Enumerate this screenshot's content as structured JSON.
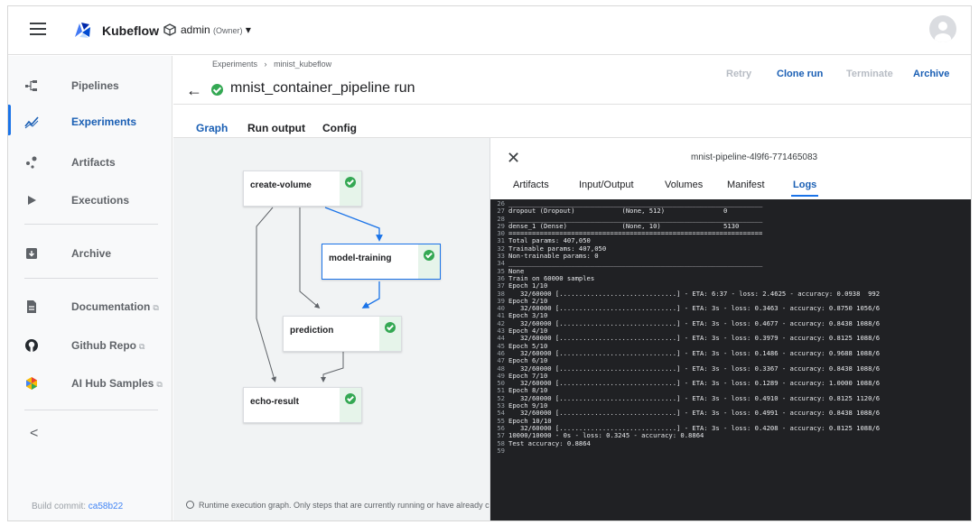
{
  "topbar": {
    "brand": "Kubeflow",
    "namespace": "admin",
    "namespace_role": "(Owner)",
    "namespace_caret": "▾"
  },
  "sidebar": {
    "items": [
      {
        "label": "Pipelines",
        "icon": "pipelines-icon"
      },
      {
        "label": "Experiments",
        "icon": "experiments-icon",
        "active": true
      },
      {
        "label": "Artifacts",
        "icon": "artifacts-icon"
      },
      {
        "label": "Executions",
        "icon": "executions-icon"
      },
      {
        "label": "Archive",
        "icon": "archive-icon"
      },
      {
        "label": "Documentation",
        "icon": "documentation-icon"
      },
      {
        "label": "Github Repo",
        "icon": "github-icon"
      },
      {
        "label": "AI Hub Samples",
        "icon": "ai-hub-icon"
      }
    ],
    "external_mark": "⧉",
    "collapse": "<",
    "build_label": "Build commit:",
    "build_commit": "ca58b22"
  },
  "header": {
    "breadcrumb": [
      "Experiments",
      "minist_kubeflow"
    ],
    "breadcrumb_sep": "›",
    "back": "←",
    "title": "mnist_container_pipeline run",
    "actions": {
      "retry": "Retry",
      "clone": "Clone run",
      "terminate": "Terminate",
      "archive": "Archive"
    }
  },
  "tabs": {
    "graph": "Graph",
    "run_output": "Run output",
    "config": "Config"
  },
  "graph": {
    "nodes": [
      "create-volume",
      "model-training",
      "prediction",
      "echo-result"
    ],
    "footer": "Runtime execution graph. Only steps that are currently running or have already completed are shown."
  },
  "panel": {
    "close": "✕",
    "title": "mnist-pipeline-4l9f6-771465083",
    "tabs": {
      "artifacts": "Artifacts",
      "io": "Input/Output",
      "volumes": "Volumes",
      "manifest": "Manifest",
      "logs": "Logs"
    }
  },
  "logs": [
    {
      "n": "26",
      "t": "_________________________________________________________________"
    },
    {
      "n": "27",
      "t": "dropout (Dropout)            (None, 512)               0"
    },
    {
      "n": "28",
      "t": "_________________________________________________________________"
    },
    {
      "n": "29",
      "t": "dense_1 (Dense)              (None, 10)                5130"
    },
    {
      "n": "30",
      "t": "================================================================="
    },
    {
      "n": "31",
      "t": "Total params: 407,050"
    },
    {
      "n": "32",
      "t": "Trainable params: 407,050"
    },
    {
      "n": "33",
      "t": "Non-trainable params: 0"
    },
    {
      "n": "34",
      "t": "_________________________________________________________________"
    },
    {
      "n": "35",
      "t": "None"
    },
    {
      "n": "36",
      "t": "Train on 60000 samples"
    },
    {
      "n": "37",
      "t": "Epoch 1/10"
    },
    {
      "n": "38",
      "t": "   32/60000 [..............................] - ETA: 6:37 - loss: 2.4625 - accuracy: 0.0938  992"
    },
    {
      "n": "39",
      "t": "Epoch 2/10"
    },
    {
      "n": "40",
      "t": "   32/60000 [..............................] - ETA: 3s - loss: 0.3463 - accuracy: 0.8750 1056/6"
    },
    {
      "n": "41",
      "t": "Epoch 3/10"
    },
    {
      "n": "42",
      "t": "   32/60000 [..............................] - ETA: 3s - loss: 0.4677 - accuracy: 0.8438 1088/6"
    },
    {
      "n": "43",
      "t": "Epoch 4/10"
    },
    {
      "n": "44",
      "t": "   32/60000 [..............................] - ETA: 3s - loss: 0.3979 - accuracy: 0.8125 1088/6"
    },
    {
      "n": "45",
      "t": "Epoch 5/10"
    },
    {
      "n": "46",
      "t": "   32/60000 [..............................] - ETA: 3s - loss: 0.1486 - accuracy: 0.9688 1088/6"
    },
    {
      "n": "47",
      "t": "Epoch 6/10"
    },
    {
      "n": "48",
      "t": "   32/60000 [..............................] - ETA: 3s - loss: 0.3367 - accuracy: 0.8438 1088/6"
    },
    {
      "n": "49",
      "t": "Epoch 7/10"
    },
    {
      "n": "50",
      "t": "   32/60000 [..............................] - ETA: 3s - loss: 0.1289 - accuracy: 1.0000 1088/6"
    },
    {
      "n": "51",
      "t": "Epoch 8/10"
    },
    {
      "n": "52",
      "t": "   32/60000 [..............................] - ETA: 3s - loss: 0.4910 - accuracy: 0.8125 1120/6"
    },
    {
      "n": "53",
      "t": "Epoch 9/10"
    },
    {
      "n": "54",
      "t": "   32/60000 [..............................] - ETA: 3s - loss: 0.4991 - accuracy: 0.8438 1088/6"
    },
    {
      "n": "55",
      "t": "Epoch 10/10"
    },
    {
      "n": "56",
      "t": "   32/60000 [..............................] - ETA: 3s - loss: 0.4208 - accuracy: 0.8125 1088/6"
    },
    {
      "n": "57",
      "t": "10000/10000 - 0s - loss: 0.3245 - accuracy: 0.8864"
    },
    {
      "n": "58",
      "t": "Test accuracy: 0.8864"
    },
    {
      "n": "59",
      "t": ""
    }
  ],
  "colors": {
    "accent": "#1a73e8",
    "success": "#34a853",
    "log_bg": "#202124"
  }
}
